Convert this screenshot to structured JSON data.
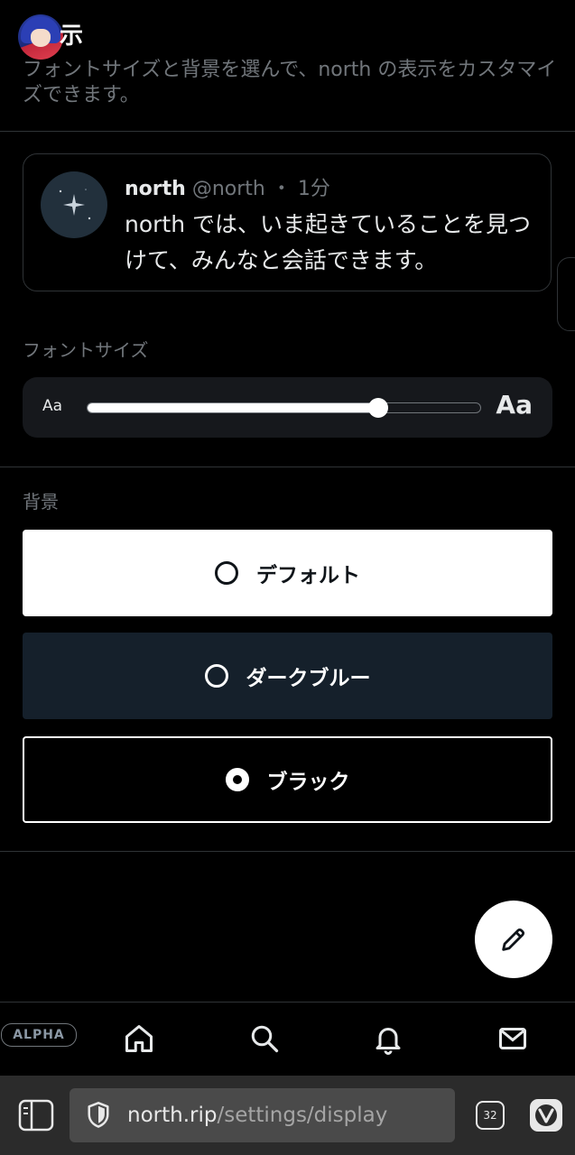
{
  "header": {
    "title": "示",
    "description": "フォントサイズと背景を選んで、north の表示をカスタマイズできます。"
  },
  "preview": {
    "name": "north",
    "handle": "@north",
    "dot": "・",
    "time": "1分",
    "text": "north では、いま起きていることを見つけて、みんなと会話できます。"
  },
  "font_size": {
    "label": "フォントサイズ",
    "small": "Aa",
    "large": "Aa",
    "level_fraction": 0.74
  },
  "background": {
    "label": "背景",
    "options": [
      {
        "label": "デフォルト",
        "selected": false
      },
      {
        "label": "ダークブルー",
        "selected": false
      },
      {
        "label": "ブラック",
        "selected": true
      }
    ]
  },
  "nav": {
    "badge": "ALPHA",
    "icons": [
      "home-icon",
      "search-icon",
      "bell-icon",
      "mail-icon"
    ]
  },
  "browser": {
    "url_domain": "north.rip",
    "url_path": "/settings/display",
    "tab_count": "32"
  },
  "colors": {
    "background": "#000000",
    "border": "#2f3336",
    "muted_text": "#71767b",
    "dim_bg": "#15202b",
    "browser_bar": "#2b2b2b"
  }
}
